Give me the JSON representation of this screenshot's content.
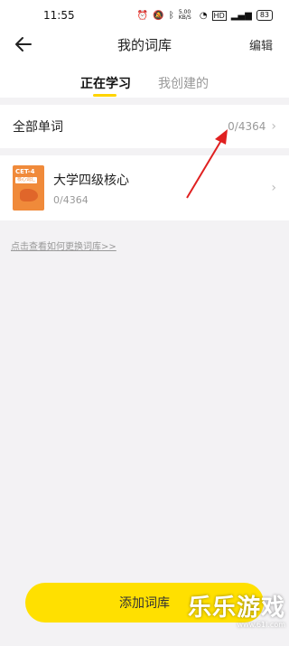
{
  "status_bar": {
    "time": "11:55",
    "icons": [
      "alarm-icon",
      "mute-icon",
      "bluetooth-icon",
      "speed-indicator",
      "wifi-icon",
      "hd-icon",
      "signal-icon",
      "battery-icon"
    ],
    "speed": "5.00 KB/S",
    "battery": "83"
  },
  "header": {
    "title": "我的词库",
    "edit_label": "编辑"
  },
  "tabs": [
    {
      "label": "正在学习",
      "active": true
    },
    {
      "label": "我创建的",
      "active": false
    }
  ],
  "all_words": {
    "label": "全部单词",
    "count": "0/4364"
  },
  "book": {
    "cover_title": "CET-4",
    "cover_tag": "核心词汇",
    "name": "大学四级核心",
    "progress": "0/4364"
  },
  "help_link": "点击查看如何更换词库>>",
  "add_button": "添加词库",
  "watermark": {
    "title": "乐乐游戏",
    "url": "www.61l.com"
  },
  "colors": {
    "accent": "#ffe000",
    "tab_underline": "#ffd400",
    "annotation_arrow": "#e02020",
    "cover": "#f08a3a"
  }
}
